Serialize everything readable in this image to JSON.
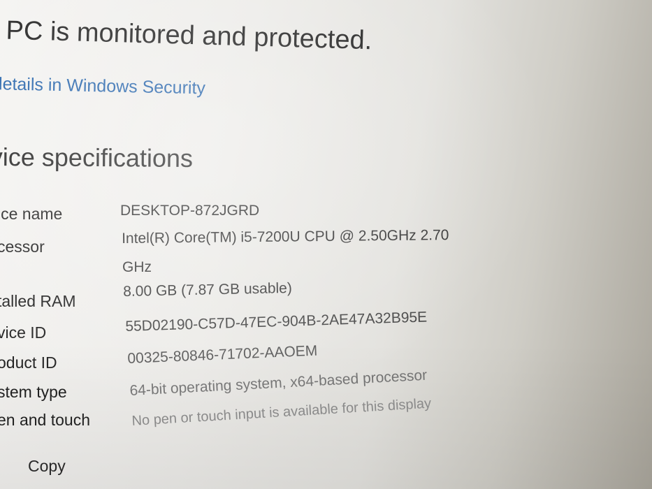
{
  "security": {
    "status_text": "r PC is monitored and protected.",
    "link_text": "details in Windows Security"
  },
  "device_specs": {
    "heading": "vice specifications",
    "rows": [
      {
        "label": "ice name",
        "value": "DESKTOP-872JGRD"
      },
      {
        "label": "cessor",
        "value": "Intel(R) Core(TM) i5-7200U CPU @ 2.50GHz   2.70",
        "value_cont": "GHz"
      },
      {
        "label": "talled RAM",
        "value": "8.00 GB (7.87 GB usable)"
      },
      {
        "label": "vice ID",
        "value": "55D02190-C57D-47EC-904B-2AE47A32B95E"
      },
      {
        "label": "oduct ID",
        "value": "00325-80846-71702-AAOEM"
      },
      {
        "label": "stem type",
        "value": "64-bit operating system, x64-based processor"
      },
      {
        "label": "en and touch",
        "value": "No pen or touch input is available for this display"
      }
    ],
    "copy_label": "Copy"
  },
  "colors": {
    "link": "#1d5ea8",
    "text": "#1c1c1c",
    "value_text": "#3a3a3a"
  }
}
